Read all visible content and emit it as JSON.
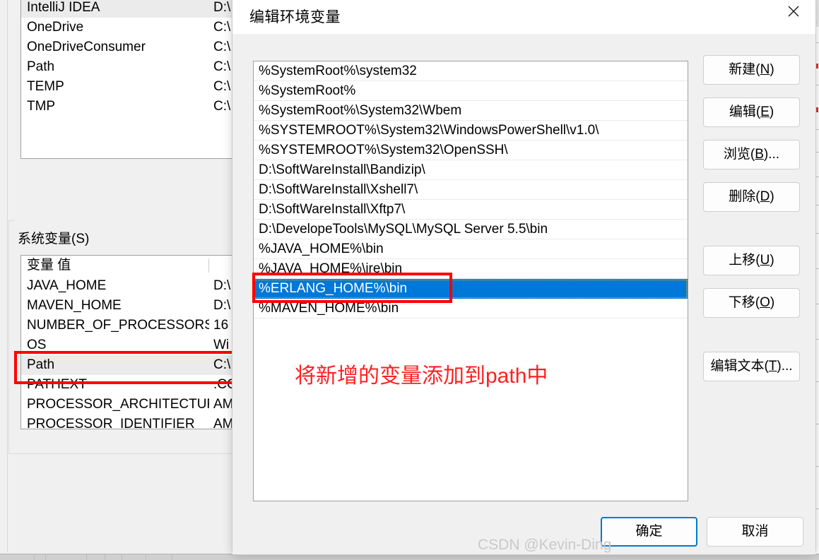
{
  "background_window": {
    "user_variables": {
      "rows": [
        {
          "name": "IntelliJ IDEA",
          "value": "D:\\"
        },
        {
          "name": "OneDrive",
          "value": "C:\\"
        },
        {
          "name": "OneDriveConsumer",
          "value": "C:\\"
        },
        {
          "name": "Path",
          "value": "C:\\"
        },
        {
          "name": "TEMP",
          "value": "C:\\"
        },
        {
          "name": "TMP",
          "value": "C:\\"
        }
      ]
    },
    "system_variables": {
      "legend": "系统变量(S)",
      "columns": {
        "name": "变量",
        "value": "值"
      },
      "rows": [
        {
          "name": "JAVA_HOME",
          "value": "D:\\"
        },
        {
          "name": "MAVEN_HOME",
          "value": "D:\\"
        },
        {
          "name": "NUMBER_OF_PROCESSORS",
          "value": "16"
        },
        {
          "name": "OS",
          "value": "Wi"
        },
        {
          "name": "Path",
          "value": "C:\\"
        },
        {
          "name": "PATHEXT",
          "value": ".CO"
        },
        {
          "name": "PROCESSOR_ARCHITECTURE",
          "value": "AM"
        },
        {
          "name": "PROCESSOR_IDENTIFIER",
          "value": "AM"
        }
      ]
    }
  },
  "dialog": {
    "title": "编辑环境变量",
    "close_icon": "close-icon",
    "path_entries": [
      "%SystemRoot%\\system32",
      "%SystemRoot%",
      "%SystemRoot%\\System32\\Wbem",
      "%SYSTEMROOT%\\System32\\WindowsPowerShell\\v1.0\\",
      "%SYSTEMROOT%\\System32\\OpenSSH\\",
      "D:\\SoftWareInstall\\Bandizip\\",
      "D:\\SoftWareInstall\\Xshell7\\",
      "D:\\SoftWareInstall\\Xftp7\\",
      "D:\\DevelopeTools\\MySQL\\MySQL Server 5.5\\bin",
      "%JAVA_HOME%\\bin",
      "%JAVA_HOME%\\jre\\bin",
      "%ERLANG_HOME%\\bin",
      "%MAVEN_HOME%\\bin"
    ],
    "selected_index": 11,
    "side_buttons": [
      {
        "id": "new",
        "label": "新建(N)",
        "text": "新建(",
        "mnemonic": "N",
        "suffix": ")"
      },
      {
        "id": "edit",
        "label": "编辑(E)",
        "text": "编辑(",
        "mnemonic": "E",
        "suffix": ")"
      },
      {
        "id": "browse",
        "label": "浏览(B)...",
        "text": "浏览(",
        "mnemonic": "B",
        "suffix": ")..."
      },
      {
        "id": "delete",
        "label": "删除(D)",
        "text": "删除(",
        "mnemonic": "D",
        "suffix": ")"
      },
      {
        "id": "moveup",
        "label": "上移(U)",
        "text": "上移(",
        "mnemonic": "U",
        "suffix": ")"
      },
      {
        "id": "movedown",
        "label": "下移(O)",
        "text": "下移(",
        "mnemonic": "O",
        "suffix": ")"
      },
      {
        "id": "edittext",
        "label": "编辑文本(T)...",
        "text": "编辑文本(",
        "mnemonic": "T",
        "suffix": ")..."
      }
    ],
    "ok_label": "确定",
    "cancel_label": "取消"
  },
  "annotations": {
    "red_note": "将新增的变量添加到path中",
    "red_color": "#ff0000",
    "highlight_path_row": "Path",
    "highlight_selected_entry": "%ERLANG_HOME%\\bin"
  },
  "watermark": "CSDN @Kevin-Ding",
  "colors": {
    "selection_blue": "#0078d7",
    "dialog_bg": "#f0f0f0",
    "annotation_red": "#ff0000"
  }
}
